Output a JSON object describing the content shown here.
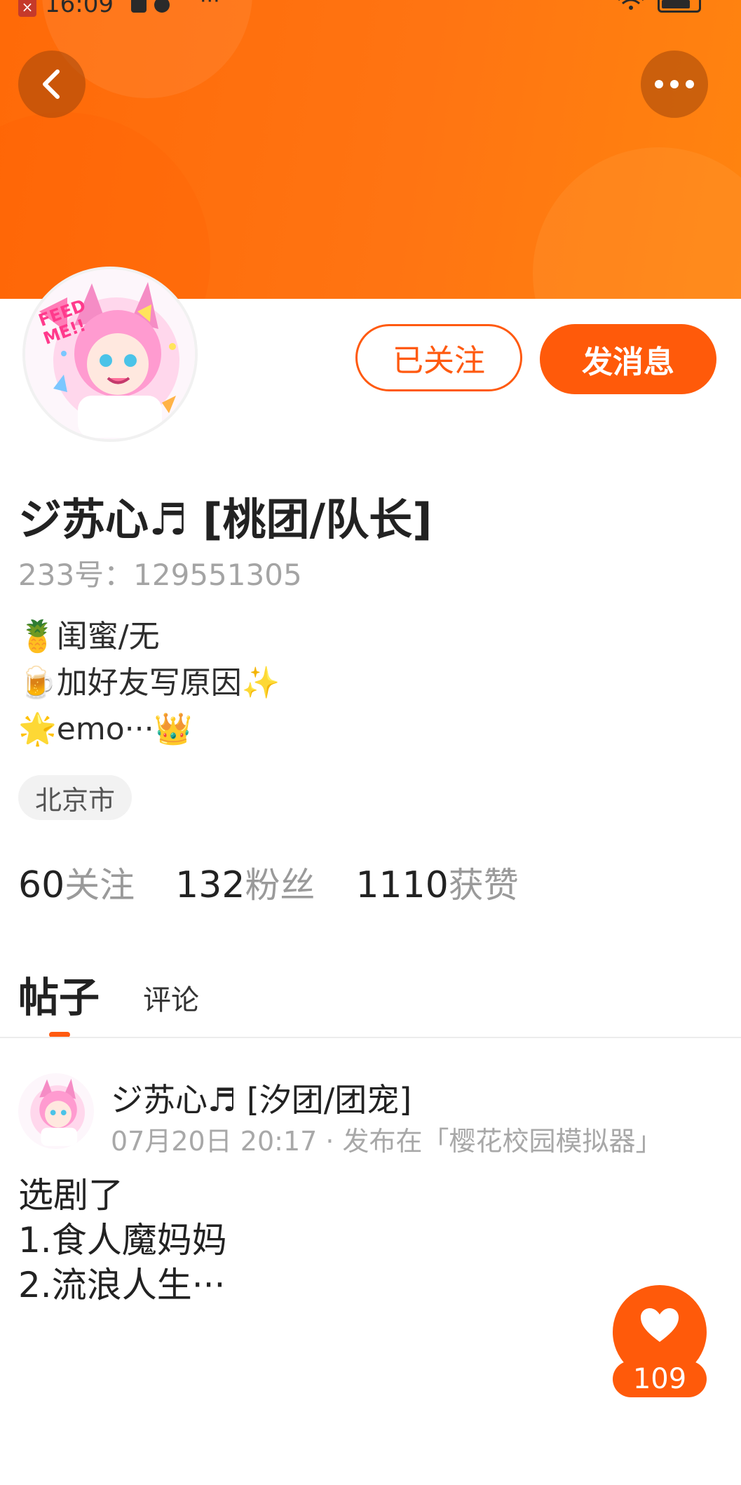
{
  "status_bar": {
    "time": "16:09"
  },
  "header": {
    "back_icon": "chevron-left-icon",
    "more_icon": "more-dots-icon"
  },
  "profile": {
    "follow_button": "已关注",
    "message_button": "发消息",
    "name": "ジ苏心♬ [桃团/队长]",
    "id_text": "233号：129551305",
    "bio": [
      {
        "emoji": "🍍",
        "text": "闺蜜/无"
      },
      {
        "emoji": "🍺",
        "text": "加好友写原因✨"
      },
      {
        "emoji": "🌟",
        "text": "emo···👑"
      }
    ],
    "location": "北京市"
  },
  "stats": [
    {
      "value": "60",
      "label": "关注"
    },
    {
      "value": "132",
      "label": "粉丝"
    },
    {
      "value": "1110",
      "label": "获赞"
    }
  ],
  "tabs": {
    "active": "帖子",
    "inactive": "评论"
  },
  "post": {
    "author": "ジ苏心♬ [汐团/团宠]",
    "meta": "07月20日 20:17 · 发布在「樱花校园模拟器」",
    "lines": [
      "选剧了",
      "1.食人魔妈妈",
      "2.流浪人生···"
    ],
    "like_count": "109"
  },
  "colors": {
    "accent": "#ff5a0a",
    "banner": "#ff7412"
  }
}
